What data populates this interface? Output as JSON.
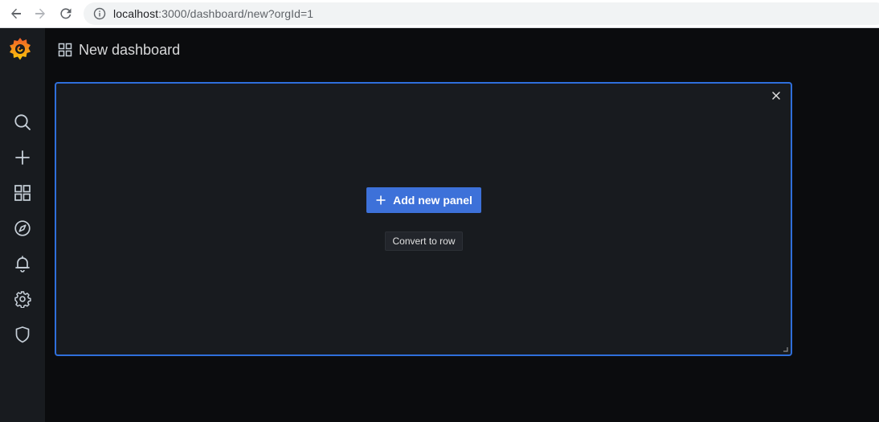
{
  "browser": {
    "url_host": "localhost",
    "url_rest": ":3000/dashboard/new?orgId=1",
    "back_icon": "arrow-left-icon",
    "forward_icon": "arrow-right-icon",
    "reload_icon": "reload-icon",
    "info_icon": "info-icon"
  },
  "sidebar": {
    "logo": "grafana-logo",
    "items": [
      {
        "name": "search",
        "icon": "search-icon"
      },
      {
        "name": "create",
        "icon": "plus-icon"
      },
      {
        "name": "dashboards",
        "icon": "apps-icon"
      },
      {
        "name": "explore",
        "icon": "compass-icon"
      },
      {
        "name": "alerting",
        "icon": "bell-icon"
      },
      {
        "name": "configuration",
        "icon": "gear-icon"
      },
      {
        "name": "server-admin",
        "icon": "shield-icon"
      }
    ]
  },
  "header": {
    "title": "New dashboard",
    "icon": "apps-icon"
  },
  "panel": {
    "add_new_panel_label": "Add new panel",
    "convert_to_row_label": "Convert to row",
    "close_icon": "close-icon"
  },
  "colors": {
    "accent": "#3d71d9",
    "panel_border": "#2f6fdb",
    "background": "#0b0c0e",
    "sidebar": "#181b1f"
  }
}
